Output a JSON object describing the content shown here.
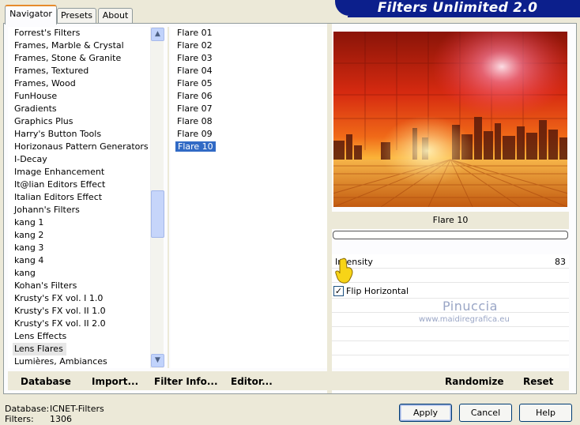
{
  "title": "Filters Unlimited 2.0",
  "tabs": [
    {
      "label": "Navigator",
      "active": true
    },
    {
      "label": "Presets",
      "active": false
    },
    {
      "label": "About",
      "active": false
    }
  ],
  "categories": [
    "Forrest's Filters",
    "Frames, Marble & Crystal",
    "Frames, Stone & Granite",
    "Frames, Textured",
    "Frames, Wood",
    "FunHouse",
    "Gradients",
    "Graphics Plus",
    "Harry's Button Tools",
    "Horizonaus Pattern Generators",
    "I-Decay",
    "Image Enhancement",
    "It@lian Editors Effect",
    "Italian Editors Effect",
    "Johann's Filters",
    "kang 1",
    "kang 2",
    "kang 3",
    "kang 4",
    "kang",
    "Kohan's Filters",
    "Krusty's FX vol. I 1.0",
    "Krusty's FX vol. II 1.0",
    "Krusty's FX vol. II 2.0",
    "Lens Effects",
    "Lens Flares",
    "Lumières, Ambiances"
  ],
  "selected_category": "Lens Flares",
  "filters": [
    "Flare 01",
    "Flare 02",
    "Flare 03",
    "Flare 04",
    "Flare 05",
    "Flare 06",
    "Flare 07",
    "Flare 08",
    "Flare 09",
    "Flare 10"
  ],
  "selected_filter": "Flare 10",
  "preview_label": "Flare 10",
  "params": {
    "intensity_label": "Intensity",
    "intensity_value": "83",
    "flip_label": "Flip Horizontal",
    "flip_checked": "✓"
  },
  "watermark": {
    "line1": "Pinuccia",
    "line2": "www.maidiregrafica.eu"
  },
  "left_toolbar": {
    "database": "Database",
    "import": "Import...",
    "filter_info": "Filter Info...",
    "editor": "Editor..."
  },
  "right_toolbar": {
    "randomize": "Randomize",
    "reset": "Reset"
  },
  "footer": {
    "database_label": "Database:",
    "database_value": "ICNET-Filters",
    "filters_label": "Filters:",
    "filters_value": "1306"
  },
  "buttons": {
    "apply": "Apply",
    "cancel": "Cancel",
    "help": "Help"
  },
  "colors": {
    "banner": "#0c1f8c",
    "selection": "#316ac5",
    "tab_highlight": "#e68b2c"
  }
}
